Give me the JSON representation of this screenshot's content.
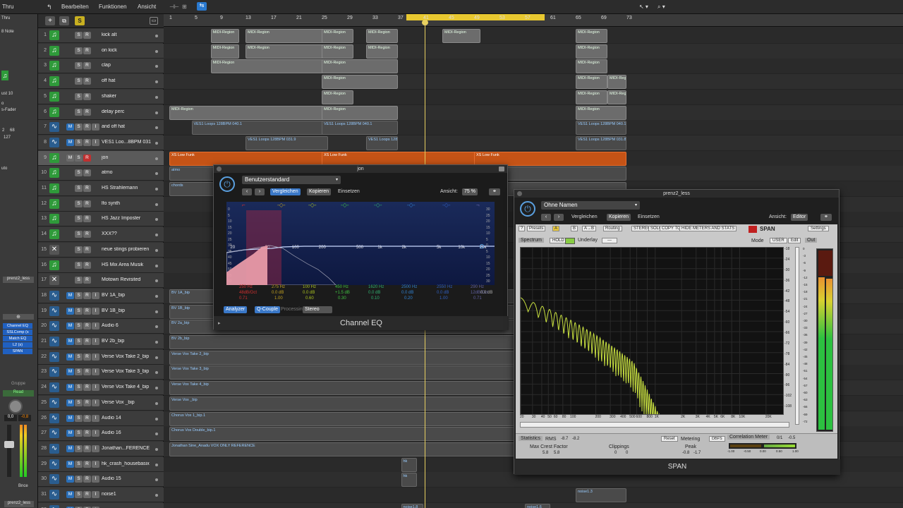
{
  "topbar": {
    "menus": [
      "Bearbeiten",
      "Funktionen",
      "Ansicht"
    ],
    "left_label": "Thru"
  },
  "inspector": {
    "lines": [
      "Thru",
      "8 Note",
      "ust 10",
      "o",
      "s-Fader",
      "2",
      "68",
      "127",
      "uto"
    ],
    "region_name": "prenz2_less",
    "plugins": [
      "Channel EQ",
      "SSLComp (s",
      "Match EQ",
      "L2 (s)",
      "SPAN"
    ],
    "group_label": "Gruppe",
    "read_label": "Read",
    "vol_left": "0,0",
    "vol_right": "-0,8",
    "bounce_label": "Bnce",
    "bottom_name": "prenz2_less"
  },
  "tracks": [
    {
      "n": "1",
      "name": "kick alt",
      "type": "midi"
    },
    {
      "n": "2",
      "name": "on kick",
      "type": "midi"
    },
    {
      "n": "3",
      "name": "clap",
      "type": "midi"
    },
    {
      "n": "4",
      "name": "off hat",
      "type": "midi"
    },
    {
      "n": "5",
      "name": "shaker",
      "type": "midi"
    },
    {
      "n": "6",
      "name": "delay perc",
      "type": "midi"
    },
    {
      "n": "7",
      "name": "and off hat",
      "type": "audio"
    },
    {
      "n": "8",
      "name": "VES1 Loo...8BPM 031",
      "type": "audio"
    },
    {
      "n": "9",
      "name": "jon",
      "type": "midi",
      "selected": true
    },
    {
      "n": "10",
      "name": "atmo",
      "type": "midi"
    },
    {
      "n": "11",
      "name": "HS Strahlemann",
      "type": "midi"
    },
    {
      "n": "12",
      "name": "lfo synth",
      "type": "midi"
    },
    {
      "n": "13",
      "name": "HS Jazz Imposter",
      "type": "midi"
    },
    {
      "n": "14",
      "name": "XXX??",
      "type": "midi"
    },
    {
      "n": "15",
      "name": "neue stings probieren",
      "type": "gray"
    },
    {
      "n": "16",
      "name": "HS Mix Area Musik",
      "type": "midi"
    },
    {
      "n": "17",
      "name": "Motown Revisited",
      "type": "gray"
    },
    {
      "n": "18",
      "name": "BV 1A_bip",
      "type": "audio"
    },
    {
      "n": "19",
      "name": "BV 1B_bip",
      "type": "audio"
    },
    {
      "n": "20",
      "name": "Audio 6",
      "type": "audio"
    },
    {
      "n": "21",
      "name": "BV 2b_bip",
      "type": "audio"
    },
    {
      "n": "22",
      "name": "Verse Vox Take 2_bip",
      "type": "audio"
    },
    {
      "n": "23",
      "name": "Verse Vox Take 3_bip",
      "type": "audio"
    },
    {
      "n": "24",
      "name": "Verse Vox Take 4_bip",
      "type": "audio"
    },
    {
      "n": "25",
      "name": "Verse Vox _bip",
      "type": "audio"
    },
    {
      "n": "26",
      "name": "Audio 14",
      "type": "audio"
    },
    {
      "n": "27",
      "name": "Audio 16",
      "type": "audio"
    },
    {
      "n": "28",
      "name": "Jonathan...FERENCE",
      "type": "audio"
    },
    {
      "n": "29",
      "name": "hk_crash_housebasix",
      "type": "audio"
    },
    {
      "n": "30",
      "name": "Audio 15",
      "type": "audio"
    },
    {
      "n": "31",
      "name": "noise1",
      "type": "audio"
    },
    {
      "n": "32",
      "name": "",
      "type": "audio"
    }
  ],
  "ruler": [
    "1",
    "5",
    "9",
    "13",
    "17",
    "21",
    "25",
    "29",
    "33",
    "37",
    "41",
    "45",
    "49",
    "53",
    "57",
    "61",
    "65",
    "69",
    "73"
  ],
  "regions": {
    "midi": "MIDI-Region",
    "loop1": "VES1 Loops 128BPM 040.1",
    "loop2": "VES1 Loops 128BPM 031.9",
    "loop3": "VES1 Loops 128BPM 031.8",
    "lowfunk": "XS Low Funk",
    "atmo": "atmo",
    "chords": "chords",
    "bv1a": "BV 1A_bip",
    "bv1b": "BV 1B_bip",
    "bv2a": "BV 2a_bip",
    "bv2b": "BV 2b_bip",
    "vt2": "Verse Vox Take 2_bip",
    "vt3": "Verse Vox Take 3_bip",
    "vt4": "Verse Vox Take 4_bip",
    "vv": "Verse Vox _bip",
    "ch1": "Chorus Vox 1_bip.1",
    "chd": "Chorus Vox Double_bip.1",
    "jref": "Jonathan Sine_Anadu VOX ONLY REFERENCE",
    "hk": "hk",
    "noise13": "noise1.3",
    "noise16": "noise1.6",
    "noise18": "noise1.8",
    "bv2": "2"
  },
  "eq": {
    "window_title": "jon",
    "preset": "Benutzerstandard",
    "compare": "Vergleichen",
    "copy": "Kopieren",
    "paste": "Einsetzen",
    "view_label": "Ansicht:",
    "view_value": "75 %",
    "freq_labels": [
      "20",
      "50",
      "100",
      "200",
      "500",
      "1k",
      "2k",
      "5k",
      "10k",
      "20k"
    ],
    "db_left": [
      "0",
      "5",
      "10",
      "15",
      "20",
      "25",
      "30",
      "35",
      "40",
      "45",
      "50",
      "55",
      "60"
    ],
    "db_right": [
      "30",
      "25",
      "20",
      "15",
      "10",
      "5",
      "0",
      "5",
      "10",
      "15",
      "20",
      "25",
      "30"
    ],
    "bands": [
      {
        "freq": "",
        "gain": "",
        "q": "0.71",
        "color": "#d03030"
      },
      {
        "freq": "275 Hz",
        "gain": "0.0 dB",
        "q": "1.00",
        "color": "#c0a020"
      },
      {
        "freq": "100 Hz",
        "gain": "0.0 dB",
        "q": "0.60",
        "color": "#a8c020"
      },
      {
        "freq": "450 Hz",
        "gain": "+1.5 dB",
        "q": "0.30",
        "color": "#40c040"
      },
      {
        "freq": "1620 Hz",
        "gain": "0.0 dB",
        "q": "0.10",
        "color": "#30b070"
      },
      {
        "freq": "2500 Hz",
        "gain": "0.0 dB",
        "q": "0.20",
        "color": "#3080d0"
      },
      {
        "freq": "2550 Hz",
        "gain": "0.0 dB",
        "q": "1.00",
        "color": "#3060c0"
      },
      {
        "freq": "290 Hz",
        "gain": "12dB/Oct",
        "q": "0.71",
        "color": "#6060a0"
      }
    ],
    "band0_line1": "250 Hz",
    "band0_line2": "48dB/Oct",
    "gain_out": "0.0 dB",
    "analyzer": "Analyzer",
    "qcouple": "Q-Couple",
    "processing": "Processing",
    "stereo": "Stereo",
    "footer": "Channel EQ"
  },
  "span": {
    "window_title": "prenz2_less",
    "preset": "Ohne Namen",
    "compare": "Vergleichen",
    "copy": "Kopieren",
    "paste": "Einsetzen",
    "view_label": "Ansicht:",
    "view_value": "Editor",
    "toolbar": [
      "?",
      "Presets",
      "A",
      "B",
      "A→B",
      "Routing",
      "STEREO",
      "SOLO",
      "COPY TO",
      "HIDE METERS AND STATS"
    ],
    "brand": "SPAN",
    "settings": "Settings",
    "spectrum_label": "Spectrum",
    "hold": "HOLD",
    "underlay": "Underlay",
    "underlay_value": "---",
    "mode_label": "Mode",
    "mode_value": "USER",
    "edit": "Edit",
    "out": "Out",
    "freq_labels": [
      "20",
      "30",
      "40",
      "50",
      "60",
      "80",
      "100",
      "200",
      "300",
      "400",
      "500",
      "600",
      "800",
      "1K",
      "2K",
      "3K",
      "4K",
      "5K",
      "6K",
      "8K",
      "10K",
      "20K"
    ],
    "db_labels": [
      "-18",
      "-24",
      "-30",
      "-36",
      "-42",
      "-48",
      "-54",
      "-60",
      "-66",
      "-72",
      "-78",
      "-84",
      "-90",
      "-96",
      "-102",
      "-108"
    ],
    "meter_labels": [
      "0",
      "-3",
      "-6",
      "-9",
      "-12",
      "-15",
      "-18",
      "-21",
      "-24",
      "-27",
      "-30",
      "-33",
      "-36",
      "-39",
      "-42",
      "-45",
      "-48",
      "-51",
      "-54",
      "-57",
      "-60",
      "-63",
      "-66",
      "-69",
      "-72"
    ],
    "statistics": "Statistics",
    "rms_label": "RMS",
    "rms_l": "-8.7",
    "rms_r": "-8.2",
    "reset": "Reset",
    "metering": "Metering",
    "dbfs": "DBFS",
    "corr_label": "Correlation Meter",
    "corr_vals": [
      "0/1",
      "-0.5"
    ],
    "crest_label": "Max Crest Factor",
    "crest_l": "5.8",
    "crest_r": "5.8",
    "clip_label": "Clippings",
    "clip_l": "0",
    "clip_r": "0",
    "peak_label": "Peak",
    "peak_l": "-0.8",
    "peak_r": "-1.7",
    "corr_scale": [
      "-1.00",
      "-0.50",
      "0.00",
      "0.50",
      "1.00"
    ],
    "footer": "SPAN"
  }
}
